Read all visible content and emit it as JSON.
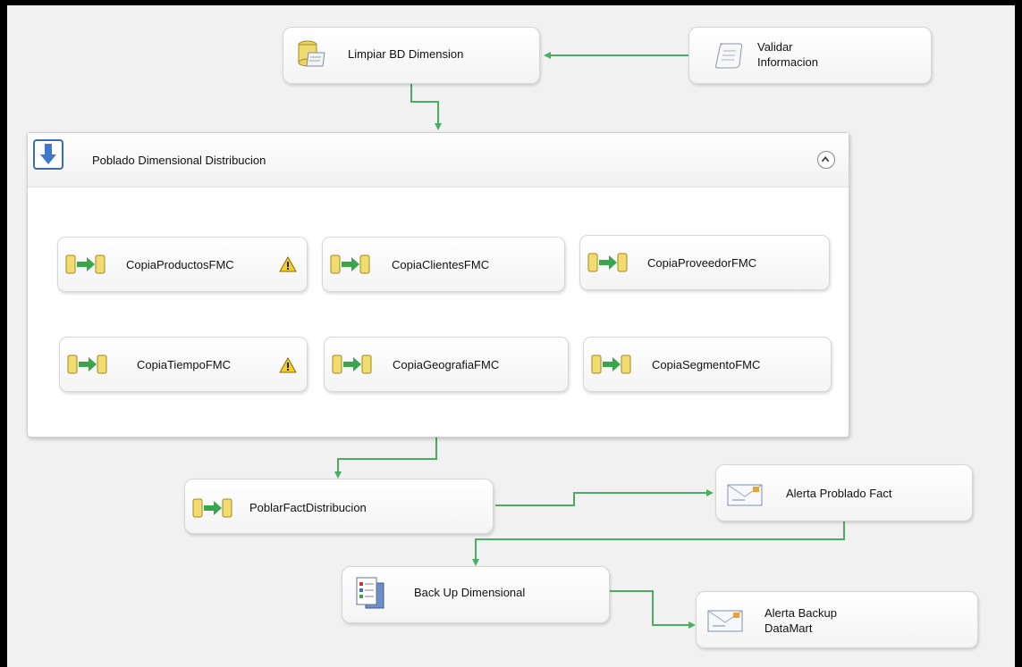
{
  "tasks": {
    "limpiar": "Limpiar BD Dimension",
    "validar_line1": "Validar",
    "validar_line2": "Informacion",
    "poblar_fact": "PoblarFactDistribucion",
    "alerta_fact": "Alerta Problado Fact",
    "backup": "Back Up Dimensional",
    "alerta_backup_line1": "Alerta Backup",
    "alerta_backup_line2": "DataMart"
  },
  "container": {
    "title": "Poblado Dimensional Distribucion",
    "tasks": [
      {
        "label": "CopiaProductosFMC",
        "warning": true
      },
      {
        "label": "CopiaClientesFMC",
        "warning": false
      },
      {
        "label": "CopiaProveedorFMC",
        "warning": false
      },
      {
        "label": "CopiaTiempoFMC",
        "warning": true
      },
      {
        "label": "CopiaGeografiaFMC",
        "warning": false
      },
      {
        "label": "CopiaSegmentoFMC",
        "warning": false
      }
    ]
  },
  "colors": {
    "connector": "#4aad62",
    "canvas": "#f1f1f1",
    "warning": "#f2cf2a"
  },
  "icons": {
    "sql_task": "database-scroll-icon",
    "script_task": "scroll-icon",
    "sequence_container": "blue-down-arrow-icon",
    "data_flow": "data-flow-icon",
    "send_mail": "envelope-icon",
    "backup": "backup-list-icon"
  }
}
